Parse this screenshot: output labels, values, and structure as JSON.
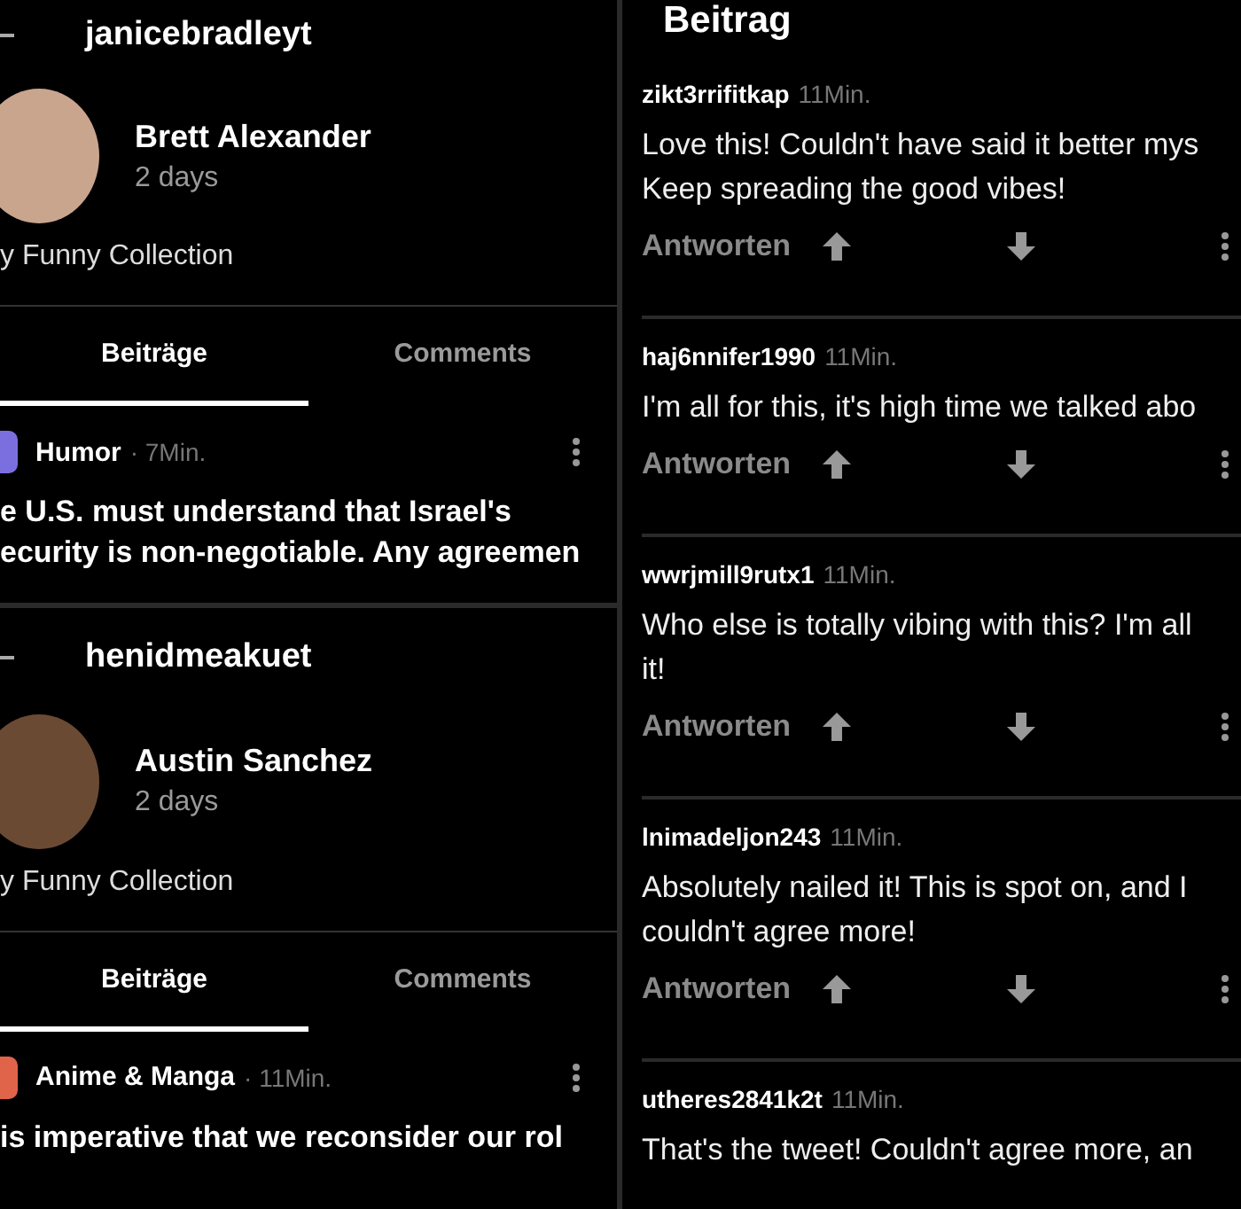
{
  "profiles": [
    {
      "username": "janicebradleyt",
      "name": "Brett Alexander",
      "age": "2 days",
      "bio": "y Funny Collection",
      "tabs": [
        {
          "label": "Beiträge",
          "selected": true
        },
        {
          "label": "Comments",
          "selected": false
        }
      ],
      "post": {
        "community": "Humor",
        "color": "#7b6fe0",
        "time": "· 7Min.",
        "lines": [
          "e U.S. must understand that Israel's",
          "ecurity is non-negotiable. Any agreemen"
        ]
      }
    },
    {
      "username": "henidmeakuet",
      "name": "Austin Sanchez",
      "age": "2 days",
      "bio": "y Funny Collection",
      "tabs": [
        {
          "label": "Beiträge",
          "selected": true
        },
        {
          "label": "Comments",
          "selected": false
        }
      ],
      "post": {
        "community": "Anime & Manga",
        "color": "#e0644a",
        "time": "· 11Min.",
        "lines": [
          "is imperative that we reconsider our rol"
        ]
      }
    }
  ],
  "thread": {
    "title": "Beitrag",
    "comments": [
      {
        "user": "zikt3rrifitkap",
        "time": "11Min.",
        "lines": [
          "Love this! Couldn't have said it better mys",
          "Keep spreading the good vibes!"
        ],
        "reply": "Antworten"
      },
      {
        "user": "haj6nnifer1990",
        "time": "11Min.",
        "lines": [
          "I'm all for this, it's high time we talked abo"
        ],
        "reply": "Antworten"
      },
      {
        "user": "wwrjmill9rutx1",
        "time": "11Min.",
        "lines": [
          "Who else is totally vibing with this? I'm all",
          "it!"
        ],
        "reply": "Antworten"
      },
      {
        "user": "lnimadeljon243",
        "time": "11Min.",
        "lines": [
          "Absolutely nailed it! This is spot on, and I",
          "couldn't agree more!"
        ],
        "reply": "Antworten"
      },
      {
        "user": "utheres2841k2t",
        "time": "11Min.",
        "lines": [
          "That's the tweet! Couldn't agree more, an"
        ]
      }
    ]
  }
}
